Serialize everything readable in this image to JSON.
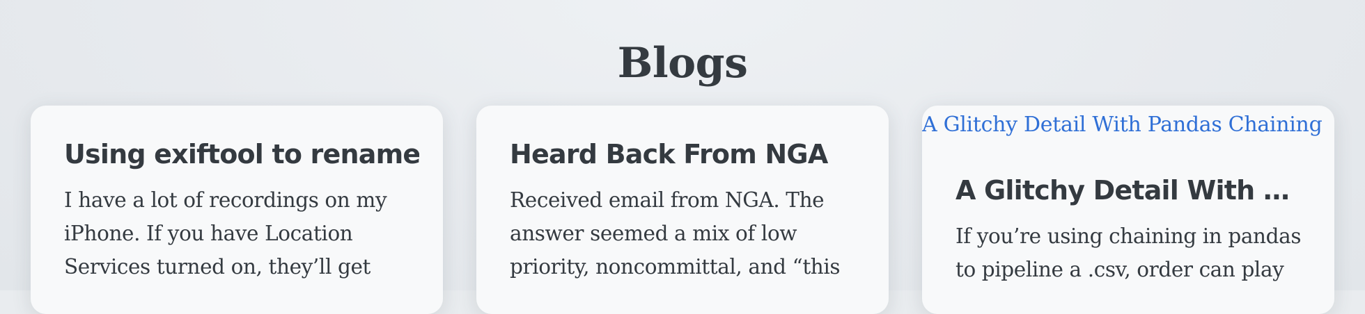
{
  "page": {
    "title": "Blogs"
  },
  "cards": [
    {
      "heading": "Using exiftool to rename …",
      "excerpt": "I have a lot of recordings on my iPhone. If you have Location Services turned on, they’ll get"
    },
    {
      "heading": "Heard Back From NGA",
      "excerpt": "Received email from NGA. The answer seemed a mix of low priority, noncommittal, and “this"
    },
    {
      "link": "A Glitchy Detail With Pandas Chaining",
      "heading": "A Glitchy Detail With …",
      "excerpt": "If you’re using chaining in pandas to pipeline a .csv, order can play"
    }
  ]
}
